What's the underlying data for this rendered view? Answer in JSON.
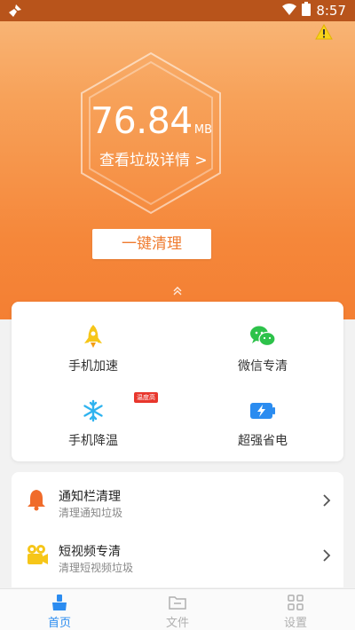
{
  "status_bar": {
    "time": "8:57"
  },
  "hero": {
    "junk_size_value": "76.84",
    "junk_size_unit": "MB",
    "details_link": "查看垃圾详情 >",
    "clean_button": "一键清理"
  },
  "tools": [
    {
      "label": "手机加速",
      "icon": "rocket-icon"
    },
    {
      "label": "微信专清",
      "icon": "wechat-icon"
    },
    {
      "label": "手机降温",
      "icon": "snowflake-icon",
      "badge": "温度高"
    },
    {
      "label": "超强省电",
      "icon": "battery-icon"
    }
  ],
  "list": [
    {
      "title": "通知栏清理",
      "subtitle": "清理通知垃圾",
      "icon": "bell-icon"
    },
    {
      "title": "短视频专清",
      "subtitle": "清理短视频垃圾",
      "icon": "video-icon"
    }
  ],
  "tabs": [
    {
      "label": "首页",
      "icon": "broom-icon",
      "active": true
    },
    {
      "label": "文件",
      "icon": "folder-icon",
      "active": false
    },
    {
      "label": "设置",
      "icon": "grid-icon",
      "active": false
    }
  ],
  "colors": {
    "accent": "#f47f33",
    "status_bar": "#b8541b",
    "tab_active": "#2b8cf0",
    "tab_inactive": "#b0b0b0"
  }
}
